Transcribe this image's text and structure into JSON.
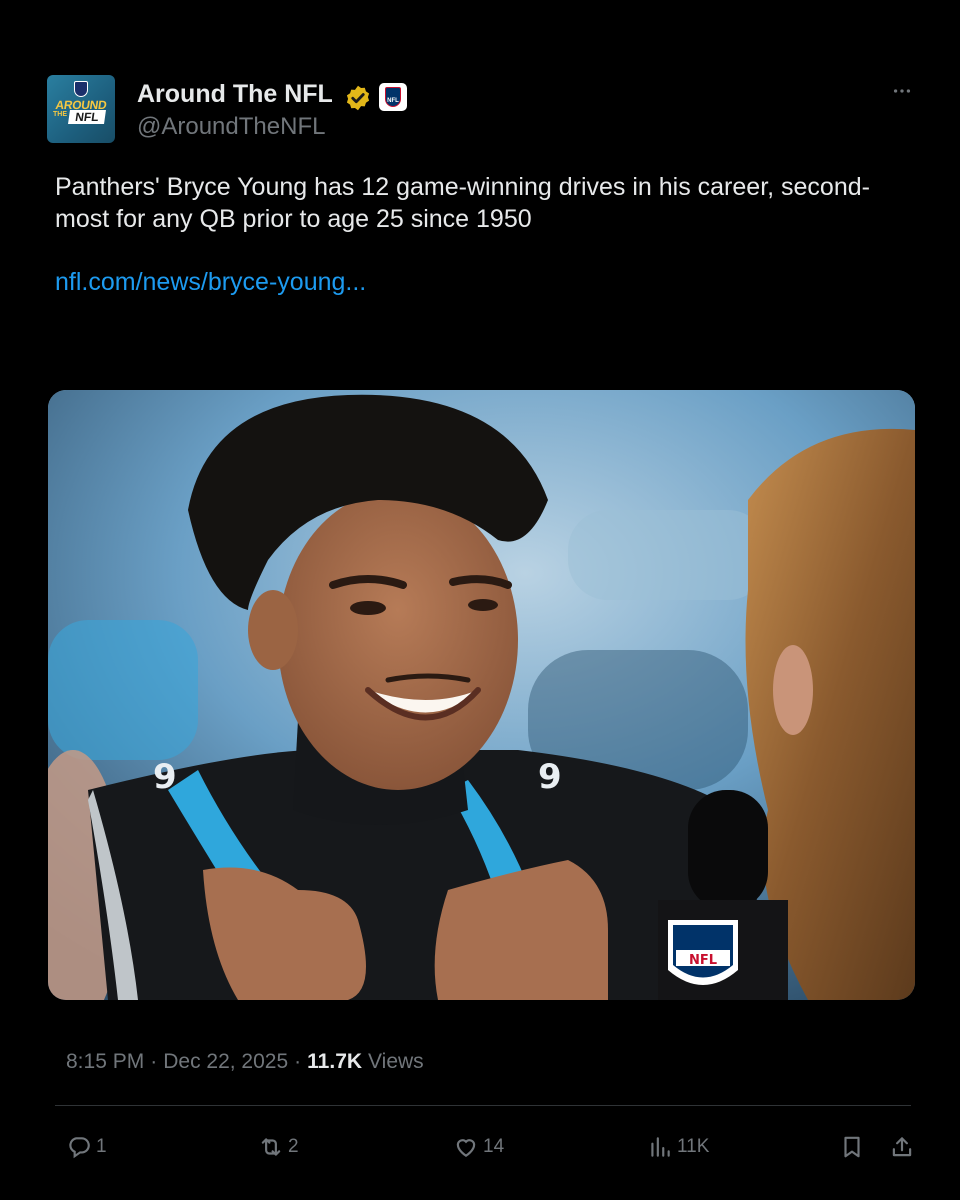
{
  "author": {
    "name": "Around The NFL",
    "handle": "@AroundTheNFL",
    "avatar_text": {
      "top": "AROUND",
      "small": "THE",
      "mark": "NFL"
    },
    "affiliate_badge_text": "NFL"
  },
  "tweet": {
    "text": "Panthers' Bryce Young has 12 game-winning drives in his career, second-most for any QB prior to age 25 since 1950",
    "link": "nfl.com/news/bryce-young..."
  },
  "media": {
    "mic_flag_text": "NFL",
    "jersey_number": "9"
  },
  "meta": {
    "time": "8:15 PM",
    "date": "Dec 22, 2025",
    "separator": "·",
    "views_count": "11.7K",
    "views_label": "Views"
  },
  "actions": {
    "reply_count": "1",
    "retweet_count": "2",
    "like_count": "14",
    "views_count": "11K"
  },
  "colors": {
    "background": "#000000",
    "text_primary": "#e7e9ea",
    "text_secondary": "#71767b",
    "link": "#1d9bf0",
    "verified_gold": "#e2b719"
  }
}
